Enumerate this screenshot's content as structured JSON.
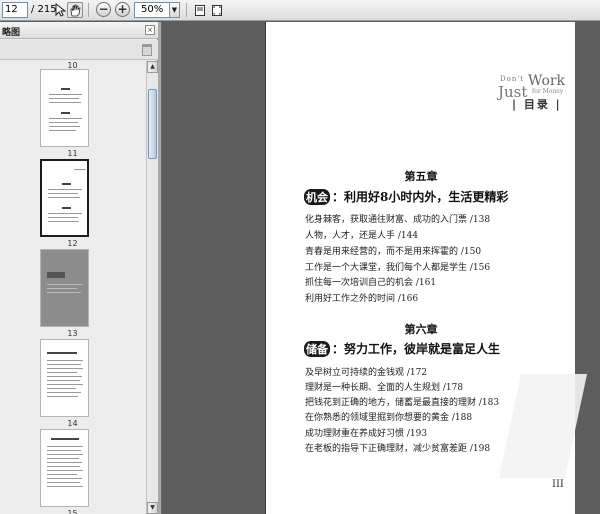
{
  "toolbar": {
    "page_value": "12",
    "page_total": "/ 215",
    "zoom_value": "50%",
    "icons": [
      "select-cursor-icon",
      "hand-tool-icon",
      "zoom-out-icon",
      "zoom-in-icon",
      "single-page-icon",
      "fit-page-icon"
    ]
  },
  "sidebar": {
    "title": "略图",
    "close_glyph": "×",
    "thumbnails": [
      {
        "label": "10"
      },
      {
        "label": "11"
      },
      {
        "label": "12"
      },
      {
        "label": "13"
      },
      {
        "label": "14"
      },
      {
        "label": "15"
      }
    ]
  },
  "document": {
    "brand": {
      "dont": "Don't",
      "just": "Just",
      "work": "Work",
      "money": "for Money"
    },
    "toc_label": "| 目录 |",
    "chapters": [
      {
        "title": "第五章",
        "badge": "机会",
        "heading": "：利用好8小时内外，生活更精彩",
        "entries": [
          "化身棘客，获取通往财富、成功的入门票 /138",
          "人物，人才，还是人手 /144",
          "青春是用来经营的，而不是用来挥霍的 /150",
          "工作是一个大课堂，我们每个人都是学生 /156",
          "抓住每一次培训自己的机会 /161",
          "利用好工作之外的时间 /166"
        ]
      },
      {
        "title": "第六章",
        "badge": "储备",
        "heading": "：努力工作，彼岸就是富足人生",
        "entries": [
          "及早树立可持续的金钱观 /172",
          "理财是一种长期、全面的人生规划 /178",
          "把钱花到正确的地方，储蓄是最直接的理财 /183",
          "在你熟悉的领域里掘到你想要的黄金 /188",
          "成功理财重在养成好习惯 /193",
          "在老板的指导下正确理财，减少贫富差距 /198"
        ]
      }
    ],
    "folio": "III"
  }
}
